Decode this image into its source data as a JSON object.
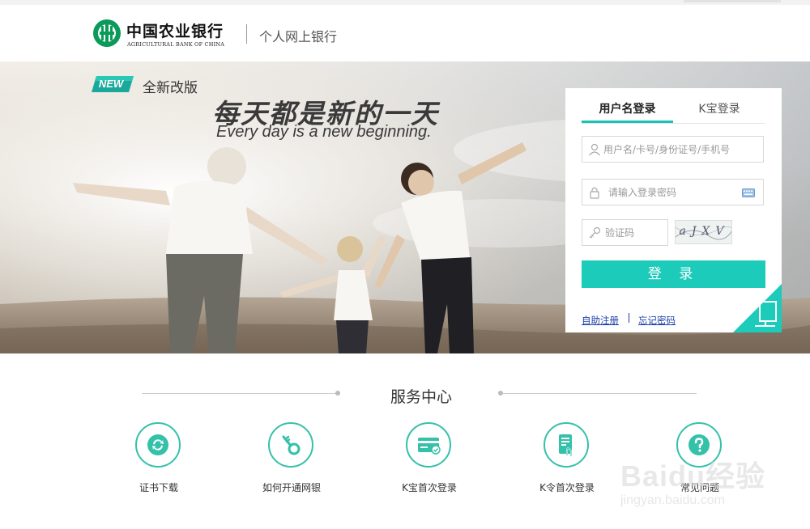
{
  "header": {
    "bank_name_cn": "中国农业银行",
    "bank_name_en": "AGRICULTURAL BANK OF CHINA",
    "subtitle": "个人网上银行"
  },
  "banner": {
    "badge": "NEW",
    "badge_label": "全新改版",
    "slogan_cn": "每天都是新的一天",
    "slogan_en": "Every day is a new beginning."
  },
  "login": {
    "tabs": [
      {
        "label": "用户名登录",
        "active": true
      },
      {
        "label": "K宝登录",
        "active": false
      }
    ],
    "username": {
      "value": "",
      "placeholder": "用户名/卡号/身份证号/手机号",
      "icon": "user-icon"
    },
    "password": {
      "value": "",
      "placeholder": "请输入登录密码",
      "icon": "lock-icon"
    },
    "captcha": {
      "value": "",
      "placeholder": "验证码",
      "icon": "key-icon",
      "image_text": "aJXV"
    },
    "submit_label": "登 录",
    "register_link": "自助注册",
    "forgot_link": "忘记密码"
  },
  "services": {
    "title": "服务中心",
    "items": [
      {
        "label": "证书下载",
        "icon": "refresh-icon"
      },
      {
        "label": "如何开通网银",
        "icon": "key-icon"
      },
      {
        "label": "K宝首次登录",
        "icon": "card-icon"
      },
      {
        "label": "K令首次登录",
        "icon": "token-icon"
      },
      {
        "label": "常见问题",
        "icon": "question-icon"
      }
    ]
  },
  "watermark": {
    "main": "Baidu经验",
    "sub": "jingyan.baidu.com"
  },
  "colors": {
    "accent": "#1dcbbb",
    "brand_green": "#0a9a5a",
    "link": "#1a3fa8",
    "service_ring": "#34c1a9"
  }
}
